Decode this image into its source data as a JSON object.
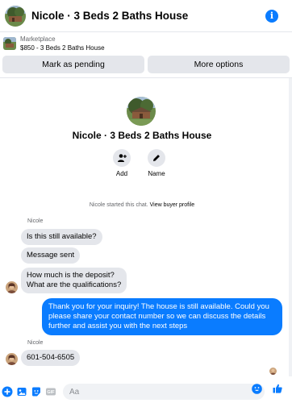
{
  "header": {
    "title": "Nicole · 3 Beds 2 Baths House",
    "info_icon": "info-icon",
    "info_glyph": "i"
  },
  "marketplace": {
    "label": "Marketplace",
    "item": "$850 - 3 Beds 2 Baths House"
  },
  "actions": {
    "pending_label": "Mark as pending",
    "more_label": "More options"
  },
  "profile": {
    "name": "Nicole · 3 Beds 2 Baths House",
    "add_label": "Add",
    "name_label": "Name"
  },
  "system": {
    "text": "Nicole started this chat.",
    "link": "View buyer profile"
  },
  "messages": {
    "sender1": "Nicole",
    "m1": "Is this still available?",
    "m2": "Message sent",
    "m3_line1": "How much is the deposit?",
    "m3_line2": "What are the qualifications?",
    "reply": "Thank you for your inquiry! The house is still available. Could you please share your contact number so we can discuss the details further and assist you with the next steps",
    "sender2": "Nicole",
    "m4": "601-504-6505"
  },
  "composer": {
    "placeholder": "Aa",
    "icons": [
      "plus-icon",
      "photo-icon",
      "sticker-icon",
      "gif-icon",
      "emoji-icon",
      "like-icon"
    ]
  },
  "colors": {
    "accent": "#0a7cff",
    "bubble_in": "#e4e6eb",
    "secondary_text": "#65676b"
  }
}
